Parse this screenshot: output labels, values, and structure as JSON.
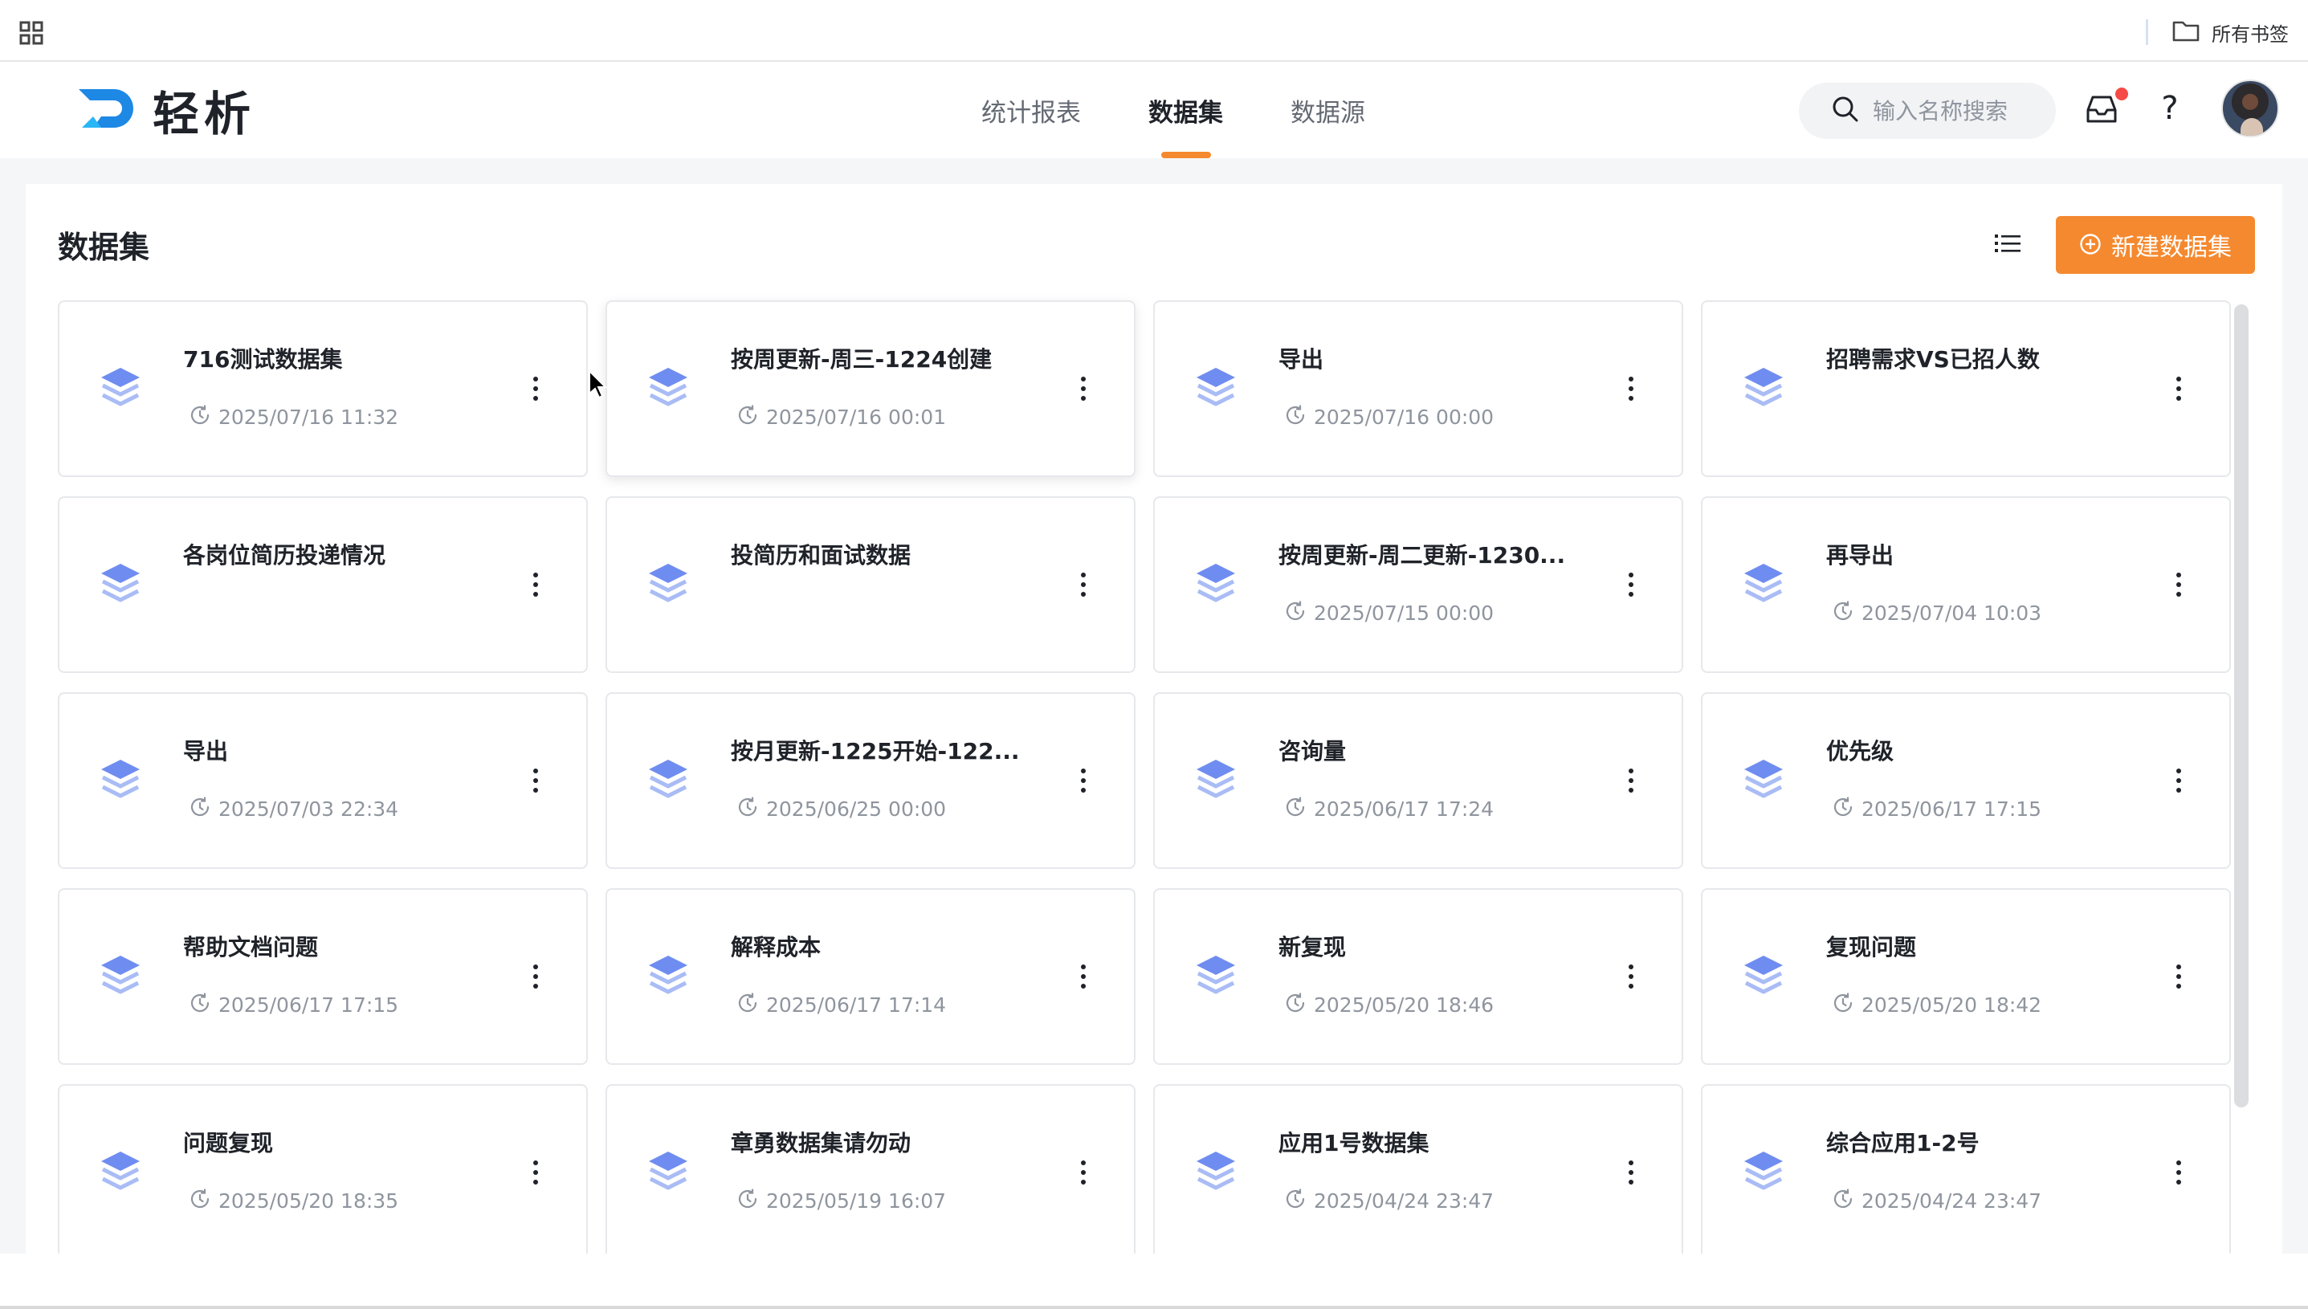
{
  "browser": {
    "bookmarks_label": "所有书签"
  },
  "header": {
    "logo_text": "轻析",
    "nav": [
      {
        "label": "统计报表",
        "active": false
      },
      {
        "label": "数据集",
        "active": true
      },
      {
        "label": "数据源",
        "active": false
      }
    ],
    "search_placeholder": "输入名称搜索",
    "inbox_unread": true,
    "help_label": "?"
  },
  "page": {
    "title": "数据集",
    "new_button_label": "新建数据集"
  },
  "datasets": [
    {
      "name": "716测试数据集",
      "time": "2025/07/16 11:32"
    },
    {
      "name": "按周更新-周三-1224创建",
      "time": "2025/07/16 00:01"
    },
    {
      "name": "导出",
      "time": "2025/07/16 00:00"
    },
    {
      "name": "招聘需求VS已招人数",
      "time": ""
    },
    {
      "name": "各岗位简历投递情况",
      "time": ""
    },
    {
      "name": "投简历和面试数据",
      "time": ""
    },
    {
      "name": "按周更新-周二更新-1230...",
      "time": "2025/07/15 00:00"
    },
    {
      "name": "再导出",
      "time": "2025/07/04 10:03"
    },
    {
      "name": "导出",
      "time": "2025/07/03 22:34"
    },
    {
      "name": "按月更新-1225开始-122...",
      "time": "2025/06/25 00:00"
    },
    {
      "name": "咨询量",
      "time": "2025/06/17 17:24"
    },
    {
      "name": "优先级",
      "time": "2025/06/17 17:15"
    },
    {
      "name": "帮助文档问题",
      "time": "2025/06/17 17:15"
    },
    {
      "name": "解释成本",
      "time": "2025/06/17 17:14"
    },
    {
      "name": "新复现",
      "time": "2025/05/20 18:46"
    },
    {
      "name": "复现问题",
      "time": "2025/05/20 18:42"
    },
    {
      "name": "问题复现",
      "time": "2025/05/20 18:35"
    },
    {
      "name": "章勇数据集请勿动",
      "time": "2025/05/19 16:07"
    },
    {
      "name": "应用1号数据集",
      "time": "2025/04/24 23:47"
    },
    {
      "name": "综合应用1-2号",
      "time": "2025/04/24 23:47"
    }
  ],
  "colors": {
    "accent": "#f5892f",
    "icon_blue": "#6f8df0",
    "icon_blue_light": "#a9bcf5",
    "badge_red": "#f54a45"
  },
  "icons": {
    "apps": "apps-grid-icon",
    "bookmark_folder": "folder-icon",
    "search": "search-icon",
    "inbox": "inbox-icon",
    "dataset": "layers-icon",
    "time": "clock-icon",
    "more": "more-vertical-icon",
    "list_view": "list-view-icon",
    "add": "plus-circle-icon"
  }
}
